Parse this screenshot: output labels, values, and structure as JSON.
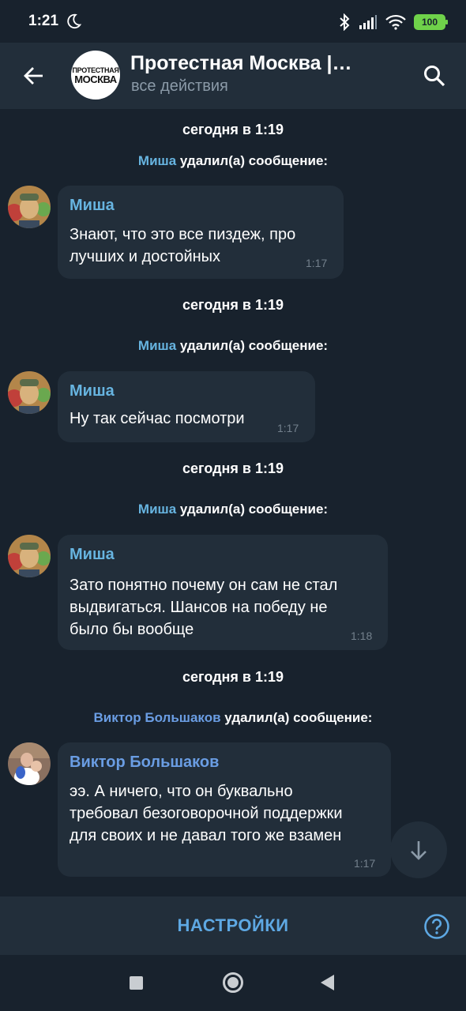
{
  "status_bar": {
    "time": "1:21",
    "battery": "100",
    "icons": [
      "moon-icon",
      "bluetooth-icon",
      "signal-icon",
      "wifi-icon",
      "battery-icon"
    ]
  },
  "header": {
    "title": "Протестная Москва |…",
    "subtitle": "все действия",
    "avatar_text_line1": "ПРОТЕСТНАЯ",
    "avatar_text_line2": "МОСКВА"
  },
  "events": [
    {
      "date": "сегодня в 1:19",
      "actor": "Миша",
      "action": "удалил(а) сообщение:",
      "message": {
        "sender": "Миша",
        "text": "Знают, что это все пиздеж, про\nлучших и достойных",
        "time": "1:17"
      }
    },
    {
      "date": "сегодня в 1:19",
      "actor": "Миша",
      "action": "удалил(а) сообщение:",
      "message": {
        "sender": "Миша",
        "text": "Ну так сейчас посмотри",
        "time": "1:17"
      }
    },
    {
      "date": "сегодня в 1:19",
      "actor": "Миша",
      "action": "удалил(а) сообщение:",
      "message": {
        "sender": "Миша",
        "text": "Зато понятно почему он сам не стал\nвыдвигаться. Шансов на победу не\nбыло бы вообще",
        "time": "1:18"
      }
    },
    {
      "date": "сегодня в 1:19",
      "actor": "Виктор Большаков",
      "action": "удалил(а) сообщение:",
      "message": {
        "sender": "Виктор Большаков",
        "text": "ээ. А ничего, что он буквально\nтребовал безоговорочной поддержки\nдля своих и не давал того же взамен",
        "time": "1:17"
      }
    }
  ],
  "bottom_bar": {
    "settings_label": "НАСТРОЙКИ"
  },
  "colors": {
    "background": "#18222d",
    "bubble": "#222e3a",
    "accent": "#5ea8e3",
    "name_misha": "#67b4e0",
    "name_viktor": "#6a9de3"
  }
}
